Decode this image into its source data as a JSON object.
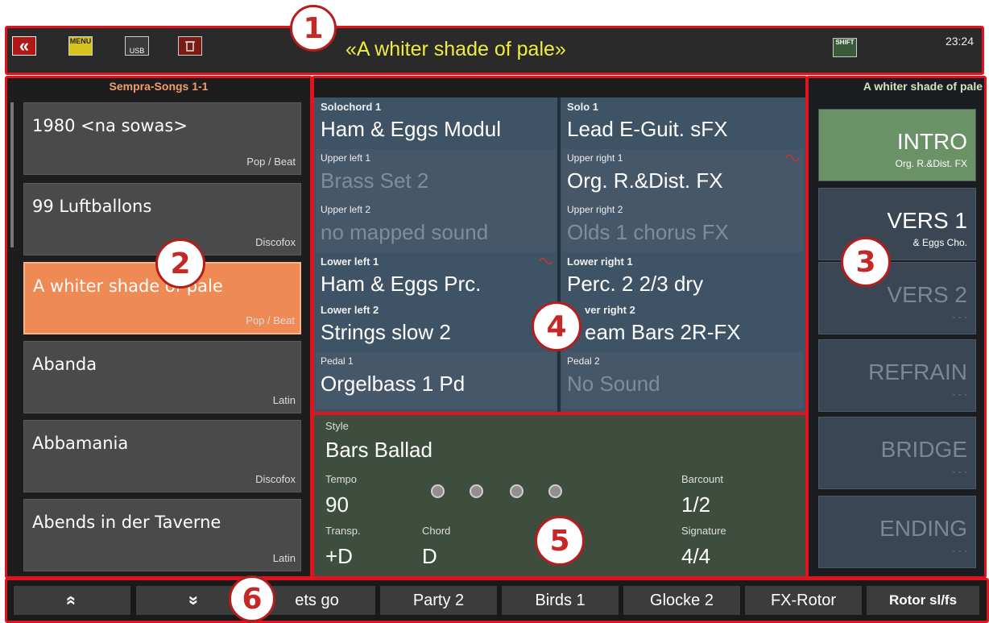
{
  "topbar": {
    "icons": [
      "back-icon",
      "menu-icon",
      "usb-icon",
      "trash-icon",
      "shift-icon"
    ],
    "back_label": "«",
    "menu_label": "MENU",
    "usb_label": "USB",
    "shift_label": "SHIFT",
    "title": "«A whiter shade of pale»",
    "time": "23:24",
    "title_color": "#f0ec3c"
  },
  "callouts": [
    "1",
    "2",
    "3",
    "4",
    "5",
    "6"
  ],
  "left_panel": {
    "title": "Sempra-Songs 1-1",
    "songs": [
      {
        "name": "1980 <na sowas>",
        "genre": "Pop / Beat"
      },
      {
        "name": "99 Luftballons",
        "genre": "Discofox"
      },
      {
        "name": "A whiter shade of pale",
        "genre": "Pop / Beat",
        "selected": true
      },
      {
        "name": "Abanda",
        "genre": "Latin"
      },
      {
        "name": "Abbamania",
        "genre": "Discofox"
      },
      {
        "name": "Abends in der Taverne",
        "genre": "Latin"
      }
    ],
    "selected_color": "#ef8a55"
  },
  "sounds": {
    "cells": [
      {
        "label": "Solochord 1",
        "value": "Ham & Eggs Modul"
      },
      {
        "label": "Solo 1",
        "value": "Lead E-Guit. sFX"
      },
      {
        "label": "Upper left 1",
        "value": "Brass Set 2"
      },
      {
        "label": "Upper right 1",
        "value": "Org. R.&Dist. FX"
      },
      {
        "label": "Upper left 2",
        "value": "no mapped sound"
      },
      {
        "label": "Upper right 2",
        "value": "Olds 1 chorus FX"
      },
      {
        "label": "Lower left 1",
        "value": "Ham & Eggs Prc."
      },
      {
        "label": "Lower right 1",
        "value": "Perc. 2 2/3 dry"
      },
      {
        "label": "Lower left 2",
        "value": "Strings slow 2"
      },
      {
        "label": "ver right 2",
        "value": "eam Bars 2R-FX"
      },
      {
        "label": "Pedal 1",
        "value": "Orgelbass 1  Pd"
      },
      {
        "label": "Pedal 2",
        "value": "No Sound"
      }
    ]
  },
  "style_panel": {
    "style_label": "Style",
    "style_value": "Bars Ballad",
    "tempo_label": "Tempo",
    "tempo_value": "90",
    "barcount_label": "Barcount",
    "barcount_value": "1/2",
    "transp_label": "Transp.",
    "transp_value": "+D",
    "chord_label": "Chord",
    "chord_value": "D",
    "signature_label": "Signature",
    "signature_value": "4/4"
  },
  "right_panel": {
    "title": "A whiter shade of pale",
    "parts": [
      {
        "name": "INTRO",
        "sub": "Org. R.&Dist. FX",
        "active": true
      },
      {
        "name": "VERS 1",
        "sub": "& Eggs Cho."
      },
      {
        "name": "VERS 2",
        "sub": "- - -"
      },
      {
        "name": "REFRAIN",
        "sub": "- - -"
      },
      {
        "name": "BRIDGE",
        "sub": "- - -"
      },
      {
        "name": "ENDING",
        "sub": "- - -"
      }
    ],
    "active_color": "#6b9167"
  },
  "bottom_bar": {
    "up_label": "«",
    "down_label": "»",
    "buttons": [
      "ets go",
      "Party 2",
      "Birds 1",
      "Glocke 2",
      "FX-Rotor",
      "Rotor sl/fs"
    ]
  },
  "border_color": "#e0141e"
}
